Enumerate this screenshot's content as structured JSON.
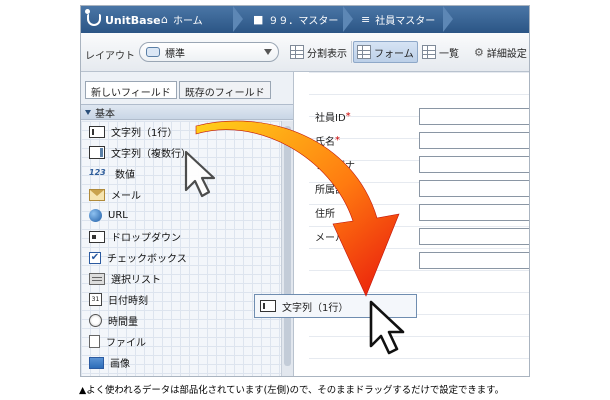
{
  "app": {
    "logo": "UnitBase"
  },
  "breadcrumb": [
    {
      "icon": "home-icon",
      "label": "ホーム"
    },
    {
      "icon": "folder-icon",
      "label": "９９．マスター"
    },
    {
      "icon": "database-icon",
      "label": "社員マスター"
    }
  ],
  "toolbar": {
    "layout_label": "レイアウト",
    "layout_value": "標準",
    "split_view": "分割表示",
    "form": "フォーム",
    "list": "一覧",
    "settings": "詳細設定"
  },
  "palette": {
    "tabs": [
      "新しいフィールド",
      "既存のフィールド"
    ],
    "section": "基本",
    "items": [
      {
        "icon": "text-single-icon",
        "label": "文字列（1行）"
      },
      {
        "icon": "text-multi-icon",
        "label": "文字列（複数行）"
      },
      {
        "icon": "number-icon",
        "glyph": "123",
        "label": "数値"
      },
      {
        "icon": "mail-icon",
        "label": "メール"
      },
      {
        "icon": "url-globe-icon",
        "label": "URL"
      },
      {
        "icon": "dropdown-icon",
        "label": "ドロップダウン"
      },
      {
        "icon": "checkbox-icon",
        "glyph": "✔",
        "label": "チェックボックス"
      },
      {
        "icon": "select-list-icon",
        "label": "選択リスト"
      },
      {
        "icon": "calendar-icon",
        "glyph": "31",
        "label": "日付時刻"
      },
      {
        "icon": "stopwatch-icon",
        "label": "時間量"
      },
      {
        "icon": "file-icon",
        "label": "ファイル"
      },
      {
        "icon": "image-icon",
        "label": "画像"
      }
    ]
  },
  "form": {
    "fields": [
      {
        "label": "社員ID",
        "required": "*",
        "value": ""
      },
      {
        "label": "氏名",
        "required": "*",
        "value": ""
      },
      {
        "label": "フリガナ",
        "required": "",
        "value": ""
      },
      {
        "label": "所属部門",
        "required": "",
        "value": ""
      },
      {
        "label": "住所",
        "required": "",
        "value": ""
      },
      {
        "label": "メールアドレス",
        "required": "",
        "value": ""
      },
      {
        "label": "",
        "required": "",
        "value": ""
      }
    ]
  },
  "drag": {
    "ghost_label": "文字列（1行）"
  },
  "caption": "▲よく使われるデータは部品化されています(左側)ので、そのままドラッグするだけで設定できます。",
  "colors": {
    "accent": "#2b5585",
    "arrow_start": "#ffcc00",
    "arrow_end": "#e8160c",
    "required": "#cc0000"
  }
}
